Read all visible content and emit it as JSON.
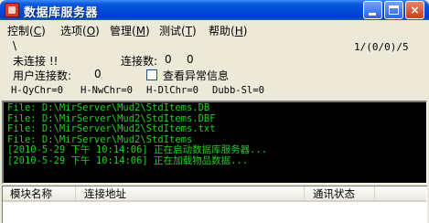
{
  "window": {
    "title": "数据库服务器",
    "buttons": {
      "minimize": "minimize",
      "maximize": "maximize",
      "close": "×"
    }
  },
  "menu": [
    {
      "label": "控制(",
      "accel": "C",
      "close": ")"
    },
    {
      "label": "选项(",
      "accel": "O",
      "close": ")"
    },
    {
      "label": "管理(",
      "accel": "M",
      "close": ")"
    },
    {
      "label": "测试(",
      "accel": "T",
      "close": ")"
    },
    {
      "label": "帮助(",
      "accel": "H",
      "close": ")"
    }
  ],
  "status": {
    "slash": "\\",
    "counter": "1/(0/0)/5",
    "connection": "未连接 !!",
    "connections_label": "连接数:",
    "connections_a": "0",
    "connections_b": "0",
    "user_connections_label": "用户连接数:",
    "user_connections_value": "0",
    "check_anomaly_label": "查看异常信息",
    "check_anomaly_checked": false,
    "metrics": [
      "H-QyChr=0",
      "H-NwChr=0",
      "H-DlChr=0",
      "Dubb-Sl=0"
    ]
  },
  "console": {
    "text_color": "#1ed21e",
    "lines": [
      "File: D:\\MirServer\\Mud2\\StdItems.DB",
      "File: D:\\MirServer\\Mud2\\StdItems.DBF",
      "File: D:\\MirServer\\Mud2\\StdItems.txt",
      "File: D:\\MirServer\\Mud2\\StdItems",
      "[2010-5-29 下午 10:14:06] 正在启动数据库服务器...",
      "[2010-5-29 下午 10:14:06] 正在加载物品数据..."
    ]
  },
  "list": {
    "columns": [
      "模块名称",
      "连接地址",
      "通讯状态"
    ]
  }
}
